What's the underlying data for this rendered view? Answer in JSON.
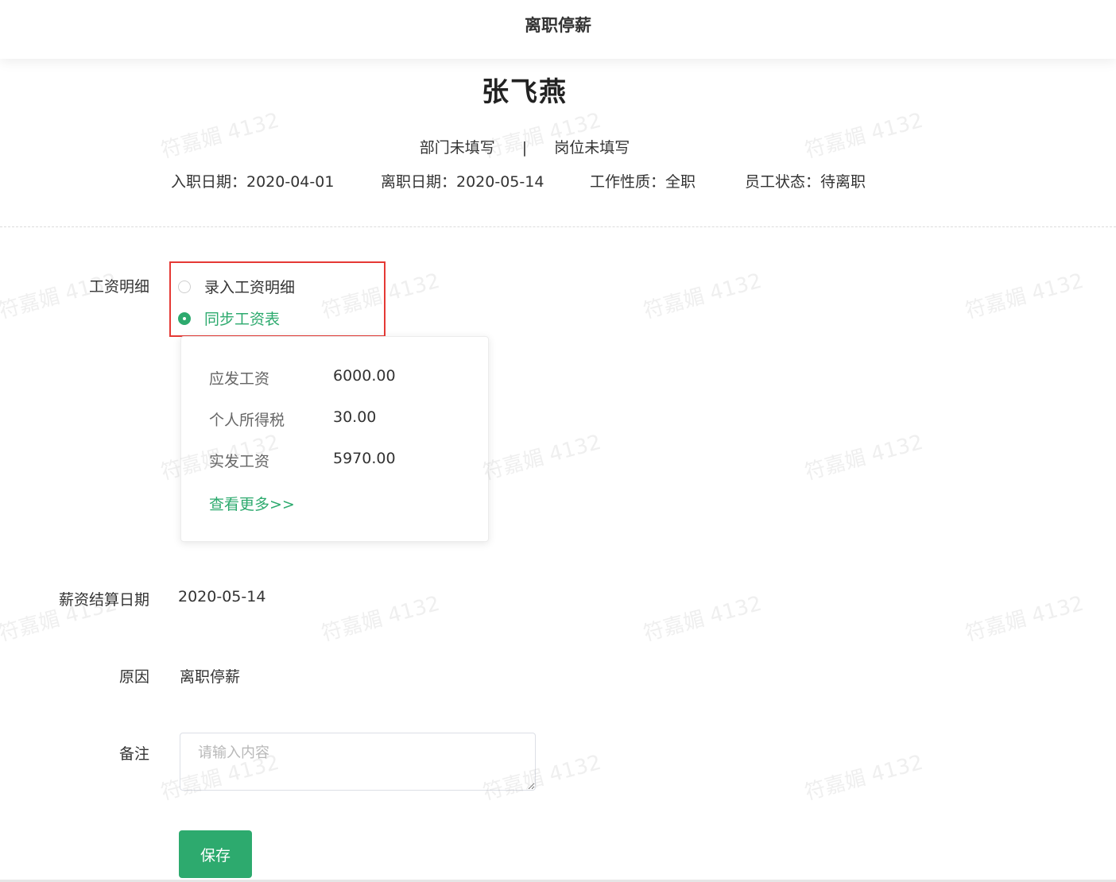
{
  "header": {
    "title": "离职停薪"
  },
  "employee": {
    "name": "张飞燕",
    "department": "部门未填写",
    "separator": "|",
    "position": "岗位未填写",
    "info": [
      {
        "label": "入职日期",
        "value": "2020-04-01",
        "text": "入职日期：2020-04-01"
      },
      {
        "label": "离职日期",
        "value": "2020-05-14",
        "text": "离职日期：2020-05-14"
      },
      {
        "label": "工作性质",
        "value": "全职",
        "text": "工作性质：全职"
      },
      {
        "label": "员工状态",
        "value": "待离职",
        "text": "员工状态：待离职"
      }
    ]
  },
  "form": {
    "salary_detail": {
      "label": "工资明细",
      "options": [
        {
          "label": "录入工资明细",
          "checked": false
        },
        {
          "label": "同步工资表",
          "checked": true
        }
      ],
      "card": {
        "rows": [
          {
            "key": "应发工资",
            "value": "6000.00"
          },
          {
            "key": "个人所得税",
            "value": "30.00"
          },
          {
            "key": "实发工资",
            "value": "5970.00"
          }
        ],
        "more_link": "查看更多>>"
      }
    },
    "settlement_date": {
      "label": "薪资结算日期",
      "value": "2020-05-14"
    },
    "reason": {
      "label": "原因",
      "value": "离职停薪"
    },
    "remark": {
      "label": "备注",
      "placeholder": "请输入内容",
      "value": ""
    },
    "save_label": "保存"
  },
  "watermark": {
    "text": "符嘉媚 4132"
  },
  "colors": {
    "accent": "#2daa6e",
    "highlight": "#e53935"
  }
}
